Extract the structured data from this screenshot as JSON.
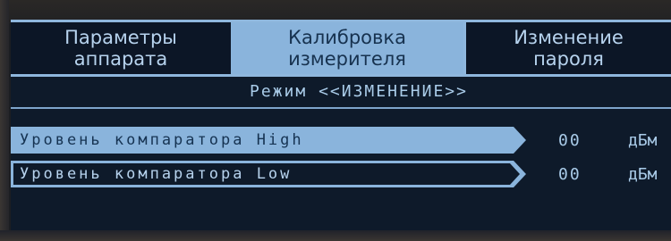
{
  "tabs": [
    {
      "line1": "Параметры",
      "line2": "аппарата"
    },
    {
      "line1": "Калибровка",
      "line2": "измерителя"
    },
    {
      "line1": "Изменение",
      "line2": "пароля"
    }
  ],
  "mode_text": "Режим <<ИЗМЕНЕНИЕ>>",
  "parameters": [
    {
      "label": "Уровень компаратора High",
      "value": "00",
      "unit": "дБм"
    },
    {
      "label": "Уровень компаратора Low",
      "value": "00",
      "unit": "дБм"
    }
  ],
  "colors": {
    "screen_bg": "#0e1a2a",
    "highlight": "#8ab4dc",
    "text": "#a9cbe8"
  }
}
